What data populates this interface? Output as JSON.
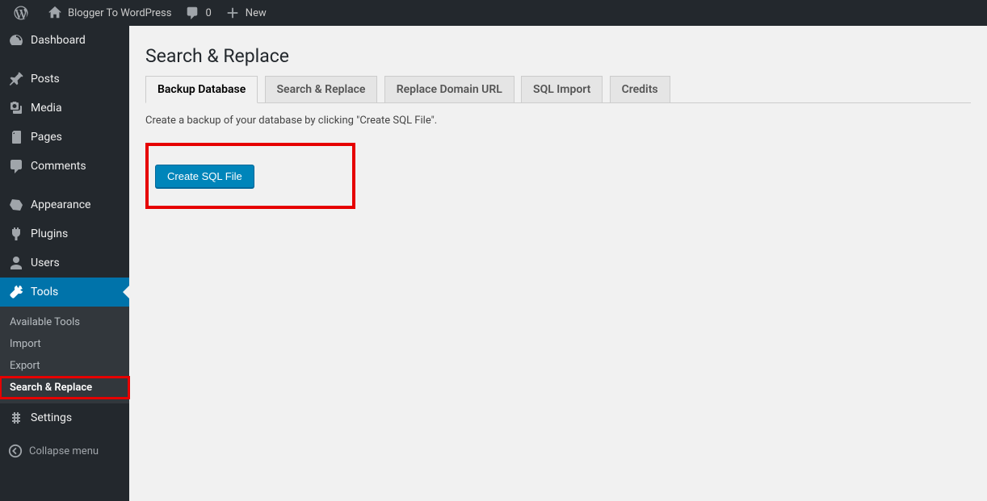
{
  "adminbar": {
    "site_title": "Blogger To WordPress",
    "comments_count": "0",
    "new_label": "New"
  },
  "sidebar": {
    "items": [
      {
        "label": "Dashboard"
      },
      {
        "label": "Posts"
      },
      {
        "label": "Media"
      },
      {
        "label": "Pages"
      },
      {
        "label": "Comments"
      },
      {
        "label": "Appearance"
      },
      {
        "label": "Plugins"
      },
      {
        "label": "Users"
      },
      {
        "label": "Tools"
      },
      {
        "label": "Settings"
      }
    ],
    "tools_submenu": [
      {
        "label": "Available Tools"
      },
      {
        "label": "Import"
      },
      {
        "label": "Export"
      },
      {
        "label": "Search & Replace"
      }
    ],
    "collapse_label": "Collapse menu"
  },
  "main": {
    "page_title": "Search & Replace",
    "tabs": [
      {
        "label": "Backup Database"
      },
      {
        "label": "Search & Replace"
      },
      {
        "label": "Replace Domain URL"
      },
      {
        "label": "SQL Import"
      },
      {
        "label": "Credits"
      }
    ],
    "description": "Create a backup of your database by clicking \"Create SQL File\".",
    "create_button": "Create SQL File"
  }
}
